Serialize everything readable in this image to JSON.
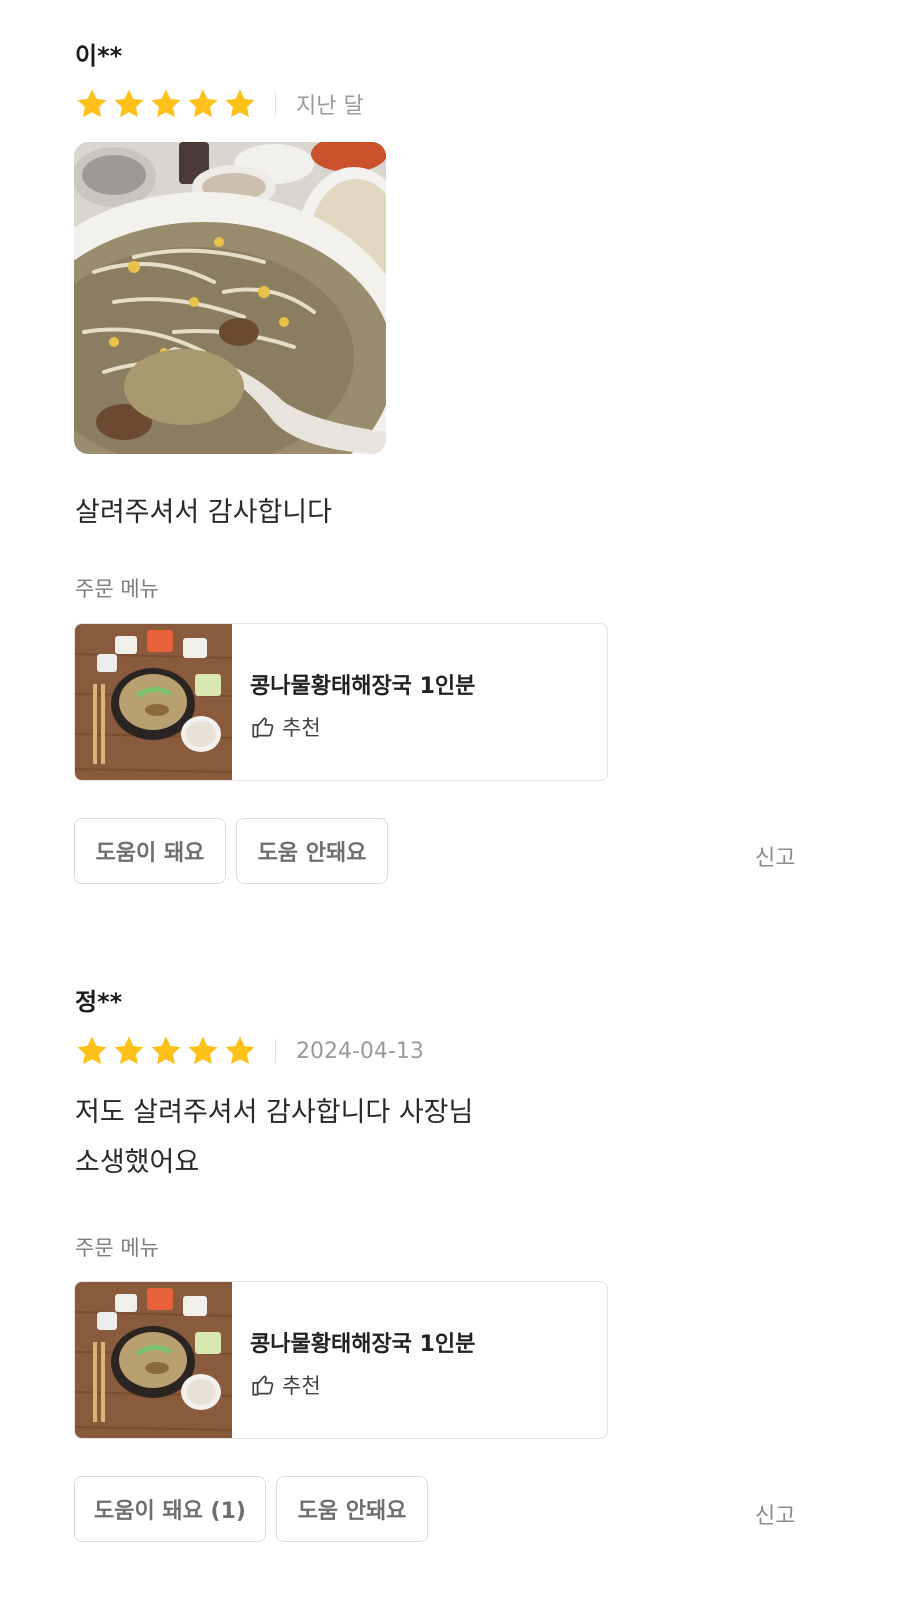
{
  "reviews": [
    {
      "author": "이**",
      "rating": 5,
      "date": "지난 달",
      "photo": "food-photo",
      "text_lines": [
        "살려주셔서 감사합니다"
      ],
      "order_menu_label": "주문 메뉴",
      "menu_item": {
        "name": "콩나물황태해장국 1인분",
        "recommend_label": "추천",
        "recommend_icon": "thumbs-up-icon"
      },
      "helpful_label": "도움이 돼요",
      "unhelpful_label": "도움 안돼요",
      "report_label": "신고"
    },
    {
      "author": "정**",
      "rating": 5,
      "date": "2024-04-13",
      "text_lines": [
        "저도 살려주셔서 감사합니다 사장님",
        "소생했어요"
      ],
      "order_menu_label": "주문 메뉴",
      "menu_item": {
        "name": "콩나물황태해장국 1인분",
        "recommend_label": "추천",
        "recommend_icon": "thumbs-up-icon"
      },
      "helpful_label": "도움이 돼요 (1)",
      "unhelpful_label": "도움 안돼요",
      "report_label": "신고"
    }
  ],
  "colors": {
    "star": "#FDC11A",
    "border": "#DCDCDC",
    "muted_text": "#9A9A9A"
  }
}
